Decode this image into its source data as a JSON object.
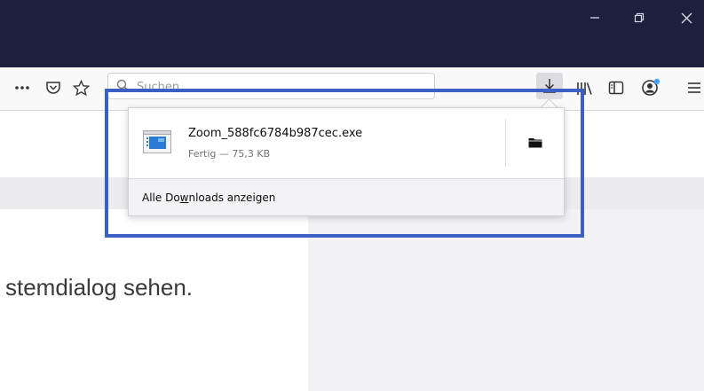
{
  "window": {
    "minimize_icon": "minimize-icon",
    "restore_icon": "restore-icon",
    "close_icon": "close-icon"
  },
  "toolbar": {
    "more_icon": "ellipsis-icon",
    "pocket_icon": "pocket-icon",
    "bookmark_icon": "star-icon",
    "search_placeholder": "Suchen",
    "download_icon": "download-arrow-icon",
    "library_icon": "library-icon",
    "sidebar_icon": "sidebar-icon",
    "account_icon": "account-icon",
    "menu_icon": "hamburger-menu-icon"
  },
  "downloads_panel": {
    "items": [
      {
        "file_name": "Zoom_588fc6784b987cec.exe",
        "status": "Fertig — 75,3 KB",
        "file_icon": "executable-file-icon",
        "action_icon": "folder-icon"
      }
    ],
    "footer_label": "Alle Do",
    "footer_accesskey": "w",
    "footer_label_rest": "nloads anzeigen"
  },
  "page": {
    "visible_text": "stemdialog sehen."
  },
  "colors": {
    "titlebar": "#1f1f3e",
    "highlight_border": "#3b5fc4",
    "account_dot": "#45a1ff"
  }
}
